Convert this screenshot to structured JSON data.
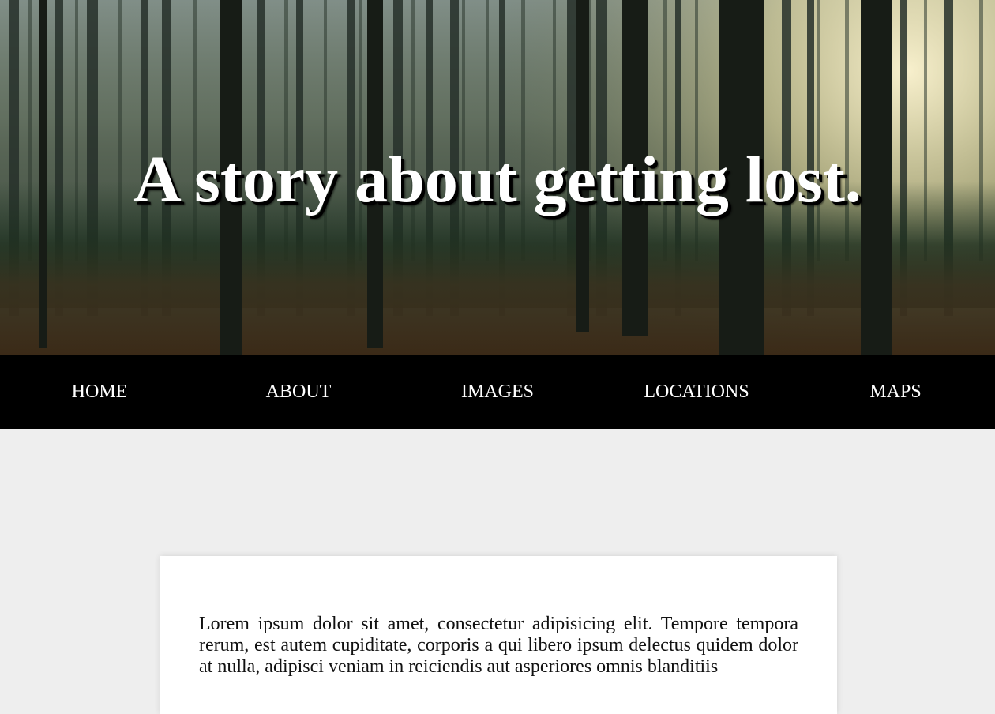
{
  "hero": {
    "title": "A story about getting lost."
  },
  "nav": {
    "items": [
      {
        "label": "HOME"
      },
      {
        "label": "ABOUT"
      },
      {
        "label": "IMAGES"
      },
      {
        "label": "LOCATIONS"
      },
      {
        "label": "MAPS"
      }
    ]
  },
  "content": {
    "paragraph": "Lorem ipsum dolor sit amet, consectetur adipisicing elit. Tempore tempora rerum, est autem cupiditate, corporis a qui libero ipsum delectus quidem dolor at nulla, adipisci veniam in reiciendis aut asperiores omnis blanditiis"
  },
  "colors": {
    "page_background": "#eeeeee",
    "nav_background": "#000000",
    "nav_text": "#ffffff",
    "card_background": "#ffffff",
    "title_text": "#ffffff"
  }
}
